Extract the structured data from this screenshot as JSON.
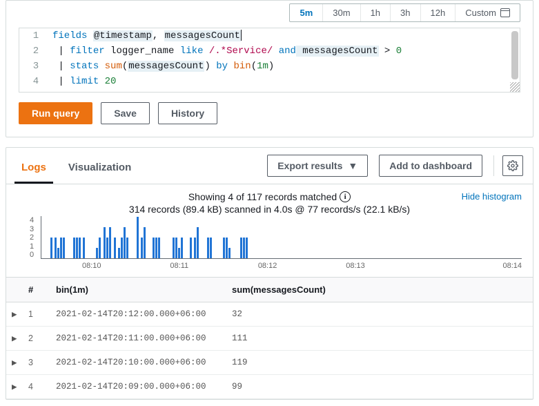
{
  "time_range": {
    "options": [
      "5m",
      "30m",
      "1h",
      "3h",
      "12h",
      "Custom"
    ],
    "active_index": 0
  },
  "editor": {
    "lines": [
      {
        "n": "1"
      },
      {
        "n": "2"
      },
      {
        "n": "3"
      },
      {
        "n": "4"
      }
    ],
    "tokens": {
      "l1_fields": "fields",
      "l1_at_timestamp": "@timestamp",
      "l1_comma": ", ",
      "l1_mc": "messagesCount",
      "l2_pipe": " | ",
      "l2_filter": "filter",
      "l2_logger": " logger_name ",
      "l2_like": "like",
      "l2_regex": " /.*Service/ ",
      "l2_and": "and",
      "l2_mc": " messagesCount",
      "l2_gt": " > ",
      "l2_zero": "0",
      "l3_pipe": " | ",
      "l3_stats": "stats",
      "l3_sum": " sum",
      "l3_open": "(",
      "l3_mc": "messagesCount",
      "l3_close": ") ",
      "l3_by": "by",
      "l3_bin": " bin",
      "l3_open2": "(",
      "l3_1m": "1m",
      "l3_close2": ")",
      "l4_pipe": " | ",
      "l4_limit": "limit",
      "l4_20": " 20"
    }
  },
  "buttons": {
    "run": "Run query",
    "save": "Save",
    "history": "History",
    "export": "Export results",
    "add_dash": "Add to dashboard"
  },
  "tabs": {
    "logs": "Logs",
    "viz": "Visualization"
  },
  "summary": {
    "line1": "Showing 4 of 117 records matched",
    "line2": "314 records (89.4 kB) scanned in 4.0s @ 77 records/s (22.1 kB/s)",
    "hide": "Hide histogram"
  },
  "chart_data": {
    "type": "bar",
    "ylim": [
      0,
      4
    ],
    "yticks": [
      "0",
      "1",
      "2",
      "3",
      "4"
    ],
    "xticks": [
      "08:10",
      "08:11",
      "08:12",
      "08:13",
      "08:14"
    ],
    "bars": [
      {
        "gap": 12,
        "h": 2
      },
      {
        "gap": 1,
        "h": 2
      },
      {
        "gap": 0,
        "h": 1
      },
      {
        "gap": 0,
        "h": 2
      },
      {
        "gap": 0,
        "h": 2
      },
      {
        "gap": 10,
        "h": 2
      },
      {
        "gap": 0,
        "h": 2
      },
      {
        "gap": 0,
        "h": 2
      },
      {
        "gap": 1,
        "h": 2
      },
      {
        "gap": 14,
        "h": 1
      },
      {
        "gap": 0,
        "h": 2
      },
      {
        "gap": 2,
        "h": 3
      },
      {
        "gap": 0,
        "h": 2
      },
      {
        "gap": 0,
        "h": 3
      },
      {
        "gap": 2,
        "h": 2
      },
      {
        "gap": 1,
        "h": 1
      },
      {
        "gap": 0,
        "h": 2
      },
      {
        "gap": 0,
        "h": 3
      },
      {
        "gap": 0,
        "h": 2
      },
      {
        "gap": 10,
        "h": 4
      },
      {
        "gap": 1,
        "h": 2
      },
      {
        "gap": 0,
        "h": 3
      },
      {
        "gap": 8,
        "h": 2
      },
      {
        "gap": 0,
        "h": 2
      },
      {
        "gap": 0,
        "h": 2
      },
      {
        "gap": 16,
        "h": 2
      },
      {
        "gap": 0,
        "h": 2
      },
      {
        "gap": 0,
        "h": 1
      },
      {
        "gap": 0,
        "h": 2
      },
      {
        "gap": 8,
        "h": 2
      },
      {
        "gap": 1,
        "h": 2
      },
      {
        "gap": 0,
        "h": 3
      },
      {
        "gap": 10,
        "h": 2
      },
      {
        "gap": 0,
        "h": 2
      },
      {
        "gap": 14,
        "h": 2
      },
      {
        "gap": 0,
        "h": 2
      },
      {
        "gap": 0,
        "h": 1
      },
      {
        "gap": 12,
        "h": 2
      },
      {
        "gap": 0,
        "h": 2
      },
      {
        "gap": 0,
        "h": 2
      }
    ]
  },
  "table": {
    "headers": {
      "hash": "#",
      "bin": "bin(1m)",
      "sum": "sum(messagesCount)"
    },
    "rows": [
      {
        "n": "1",
        "bin": "2021-02-14T20:12:00.000+06:00",
        "sum": "32"
      },
      {
        "n": "2",
        "bin": "2021-02-14T20:11:00.000+06:00",
        "sum": "111"
      },
      {
        "n": "3",
        "bin": "2021-02-14T20:10:00.000+06:00",
        "sum": "119"
      },
      {
        "n": "4",
        "bin": "2021-02-14T20:09:00.000+06:00",
        "sum": "99"
      }
    ]
  }
}
